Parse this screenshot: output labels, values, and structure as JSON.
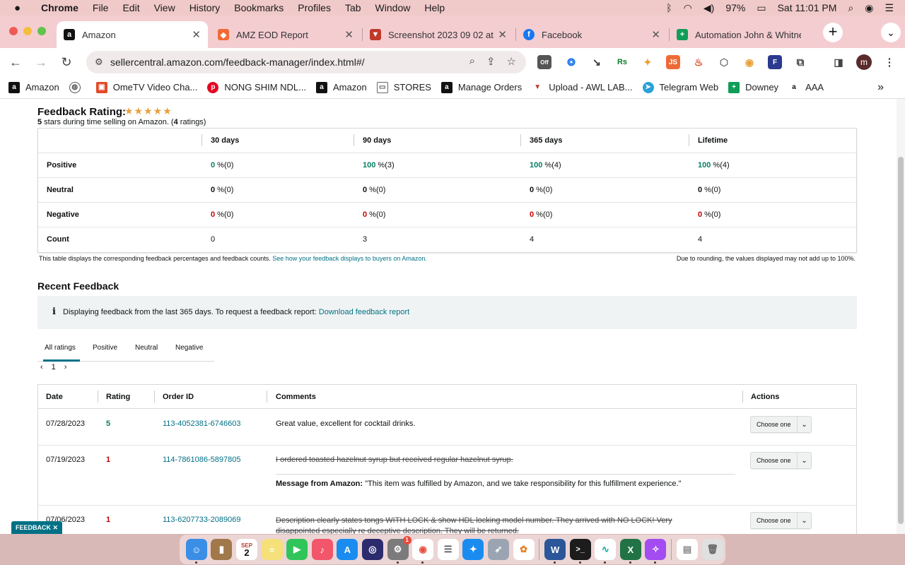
{
  "menubar": {
    "app": "Chrome",
    "items": [
      "File",
      "Edit",
      "View",
      "History",
      "Bookmarks",
      "Profiles",
      "Tab",
      "Window",
      "Help"
    ],
    "battery": "97%",
    "clock": "Sat 11:01 PM"
  },
  "tabs": [
    {
      "title": "Amazon",
      "icon": "amazon-icon"
    },
    {
      "title": "AMZ EOD Report",
      "icon": "report-icon"
    },
    {
      "title": "Screenshot 2023 09 02 at",
      "icon": "screenshot-icon"
    },
    {
      "title": "Facebook",
      "icon": "facebook-icon"
    },
    {
      "title": "Automation John & Whitne",
      "icon": "sheets-icon"
    }
  ],
  "toolbar": {
    "url": "sellercentral.amazon.com/feedback-manager/index.html#/",
    "profile_initial": "m",
    "ext_off_label": "Off",
    "ext_js_label": "JS"
  },
  "bookmarks": [
    {
      "label": "Amazon",
      "icon": "amazon-icon"
    },
    {
      "label": "",
      "icon": "globe-icon"
    },
    {
      "label": "OmeTV Video Cha...",
      "icon": "ometv-icon"
    },
    {
      "label": "NONG SHIM NDL...",
      "icon": "pinterest-icon"
    },
    {
      "label": "Amazon",
      "icon": "amazon-icon"
    },
    {
      "label": "STORES",
      "icon": "folder-icon"
    },
    {
      "label": "Manage Orders",
      "icon": "amazon-icon"
    },
    {
      "label": "Upload - AWL LAB...",
      "icon": "awl-icon"
    },
    {
      "label": "Telegram Web",
      "icon": "telegram-icon"
    },
    {
      "label": "Downey",
      "icon": "sheets-icon"
    },
    {
      "label": "AAA",
      "icon": "amazon-icon"
    }
  ],
  "feedback_rating": {
    "title": "Feedback Rating:",
    "stars": 5,
    "stars_value": "5",
    "summary_a": " stars during time selling on Amazon. (",
    "ratings_count": "4",
    "summary_b": " ratings)"
  },
  "rating_table": {
    "columns": [
      "30 days",
      "90 days",
      "365 days",
      "Lifetime"
    ],
    "rows": [
      {
        "label": "Positive",
        "cells": [
          {
            "v": "0",
            "s": " %(0)"
          },
          {
            "v": "100",
            "s": " %(3)"
          },
          {
            "v": "100",
            "s": " %(4)"
          },
          {
            "v": "100",
            "s": " %(4)"
          }
        ]
      },
      {
        "label": "Neutral",
        "cells": [
          {
            "v": "0",
            "s": " %(0)"
          },
          {
            "v": "0",
            "s": " %(0)"
          },
          {
            "v": "0",
            "s": " %(0)"
          },
          {
            "v": "0",
            "s": " %(0)"
          }
        ]
      },
      {
        "label": "Negative",
        "cells": [
          {
            "v": "0",
            "s": " %(0)"
          },
          {
            "v": "0",
            "s": " %(0)"
          },
          {
            "v": "0",
            "s": " %(0)"
          },
          {
            "v": "0",
            "s": " %(0)"
          }
        ]
      },
      {
        "label": "Count",
        "cells": [
          {
            "v": "",
            "s": "0"
          },
          {
            "v": "",
            "s": "3"
          },
          {
            "v": "",
            "s": "4"
          },
          {
            "v": "",
            "s": "4"
          }
        ]
      }
    ],
    "note_left": "This table displays the corresponding feedback percentages and feedback counts.",
    "note_link": "See how your feedback displays to buyers on Amazon.",
    "note_right": "Due to rounding, the values displayed may not add up to 100%."
  },
  "recent": {
    "title": "Recent Feedback",
    "info_icon": "i",
    "info_text": "Displaying feedback from the last 365 days. To request a feedback report:",
    "info_link": "Download feedback report",
    "tabs": [
      "All ratings",
      "Positive",
      "Neutral",
      "Negative"
    ],
    "page": "1",
    "columns": [
      "Date",
      "Rating",
      "Order ID",
      "Comments",
      "Actions"
    ],
    "action_label": "Choose one",
    "rows": [
      {
        "date": "07/28/2023",
        "rating": "5",
        "order": "113-4052381-6746603",
        "comment": "Great value, excellent for cocktail drinks."
      },
      {
        "date": "07/19/2023",
        "rating": "1",
        "order": "114-7861086-5897805",
        "comment": "I ordered toasted hazelnut syrup but received regular hazelnut syrup.",
        "msg_label": "Message from Amazon:",
        "msg_text": " \"This item was fulfilled by Amazon, and we take responsibility for this fulfillment experience.\""
      },
      {
        "date": "07/06/2023",
        "rating": "1",
        "order": "113-6207733-2089069",
        "comment": "Description clearly states tongs WITH LOCK & show HDL locking model number. They arrived with NO LOCK! Very disappointed especially re deceptive description. They will be returned."
      }
    ]
  },
  "feedback_button": "FEEDBACK",
  "dock": {
    "calendar_month": "SEP",
    "calendar_day": "2",
    "settings_badge": "1"
  }
}
